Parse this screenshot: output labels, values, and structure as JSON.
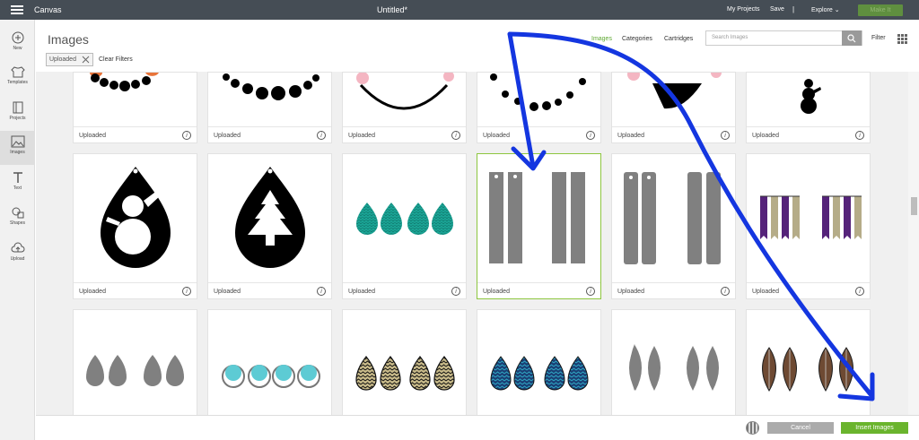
{
  "topbar": {
    "app_name": "Canvas",
    "doc_title": "Untitled*",
    "my_projects": "My Projects",
    "save": "Save",
    "separator": "|",
    "explore": "Explore",
    "make_it": "Make It"
  },
  "sidebar": {
    "items": [
      {
        "label": "New",
        "icon": "plus-icon"
      },
      {
        "label": "Templates",
        "icon": "shirt-icon"
      },
      {
        "label": "Projects",
        "icon": "projects-icon"
      },
      {
        "label": "Images",
        "icon": "image-icon"
      },
      {
        "label": "Text",
        "icon": "text-icon"
      },
      {
        "label": "Shapes",
        "icon": "shapes-icon"
      },
      {
        "label": "Upload",
        "icon": "upload-icon"
      }
    ]
  },
  "header": {
    "title": "Images",
    "tabs": [
      "Images",
      "Categories",
      "Cartridges"
    ],
    "search_placeholder": "Search Images",
    "filter_label": "Filter",
    "chip_label": "Uploaded",
    "clear_filters": "Clear Filters"
  },
  "cards": {
    "footer_label": "Uploaded",
    "info_glyph": "i",
    "rows": [
      [
        "dots-necklace-partial",
        "dots-necklace",
        "snowman-smile",
        "dots-smile",
        "snowman-face-mouth",
        "snowman-small"
      ],
      [
        "teardrop-snowman",
        "teardrop-tree",
        "scallop-teardrops",
        "bar-earrings",
        "bar-earrings-rounded",
        "ribbon-tassels"
      ],
      [
        "gray-pear-drops",
        "circle-hoops",
        "chevron-teardrops",
        "blue-chevron-teardrops",
        "gray-leaves",
        "brown-leaves"
      ]
    ],
    "selected": "bar-earrings"
  },
  "bottombar": {
    "cancel": "Cancel",
    "insert": "Insert Images"
  },
  "colors": {
    "topbar": "#454d55",
    "accent_green": "#6ab42d",
    "annotation_blue": "#1436e0"
  }
}
